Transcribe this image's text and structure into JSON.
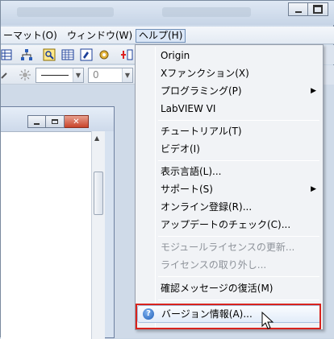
{
  "menubar": {
    "items": [
      {
        "label": "ーマット(O)"
      },
      {
        "label": "ウィンドウ(W)"
      },
      {
        "label": "ヘルプ(H)"
      }
    ]
  },
  "toolbar2": {
    "line_combo_value": "",
    "size_combo_value": "0"
  },
  "help_menu": {
    "items": [
      {
        "label": "Origin",
        "disabled": false
      },
      {
        "label": "Xファンクション(X)",
        "disabled": false
      },
      {
        "label": "プログラミング(P)",
        "disabled": false,
        "submenu": true
      },
      {
        "label": "LabVIEW VI",
        "disabled": false
      },
      {
        "label": "チュートリアル(T)",
        "disabled": false
      },
      {
        "label": "ビデオ(I)",
        "disabled": false
      },
      {
        "label": "表示言語(L)...",
        "disabled": false
      },
      {
        "label": "サポート(S)",
        "disabled": false,
        "submenu": true
      },
      {
        "label": "オンライン登録(R)...",
        "disabled": false
      },
      {
        "label": "アップデートのチェック(C)...",
        "disabled": false
      },
      {
        "label": "モジュールライセンスの更新...",
        "disabled": true
      },
      {
        "label": "ライセンスの取り外し...",
        "disabled": true
      },
      {
        "label": "確認メッセージの復活(M)",
        "disabled": false
      },
      {
        "label": "バージョン情報(A)...",
        "disabled": false,
        "highlighted": true
      }
    ],
    "submenu_arrow": "▶",
    "help_icon_glyph": "?"
  },
  "colors": {
    "highlight_border": "#d8231d",
    "menu_bg": "#f1f3f6"
  }
}
